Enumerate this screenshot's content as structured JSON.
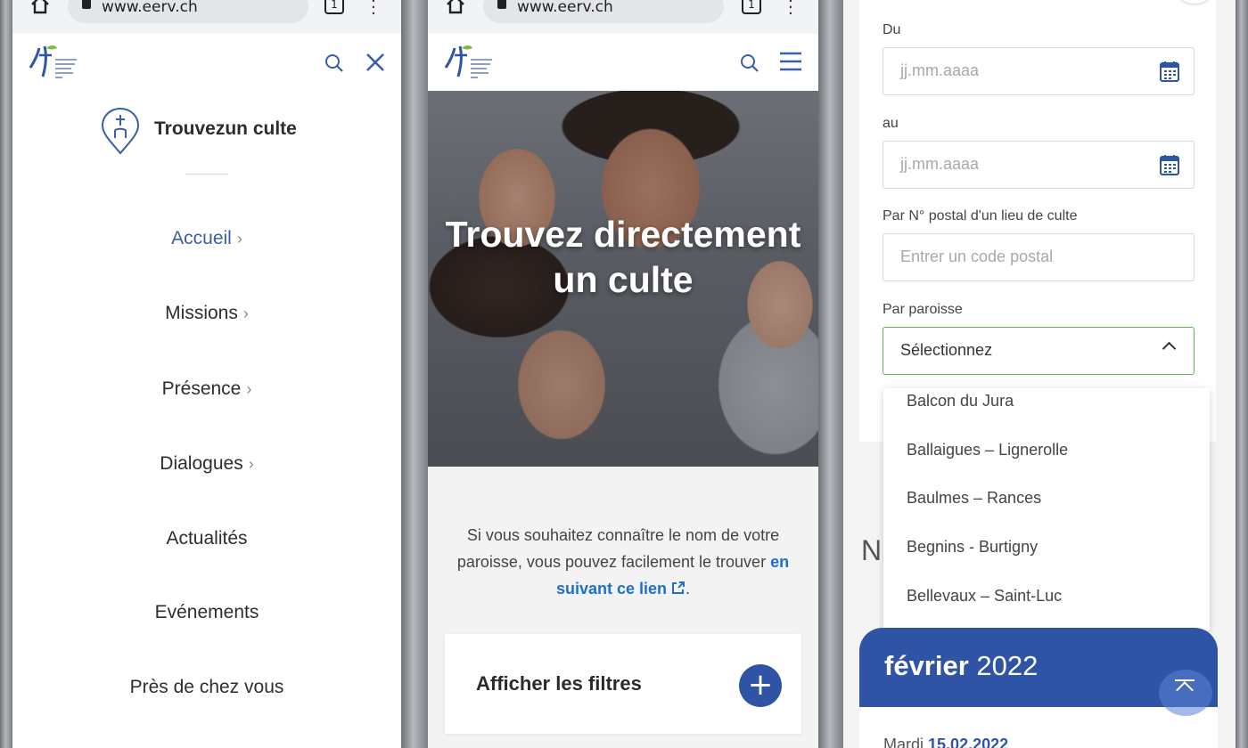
{
  "browser": {
    "url": "www.eerv.ch",
    "tab_count": "1"
  },
  "menu": {
    "find_title": "Trouvezun culte",
    "items": [
      {
        "label": "Accueil",
        "chevron": "›"
      },
      {
        "label": "Missions",
        "chevron": "›"
      },
      {
        "label": "Présence",
        "chevron": "›"
      },
      {
        "label": "Dialogues",
        "chevron": "›"
      },
      {
        "label": "Actualités"
      },
      {
        "label": "Evénements"
      },
      {
        "label": "Près de chez vous"
      }
    ]
  },
  "landing": {
    "hero_title": "Trouvez directement un culte",
    "intro_before": "Si vous souhaitez connaître le nom de votre paroisse, vous pouvez facilement le trouver ",
    "intro_link": "en suivant ce lien",
    "intro_after": ".",
    "filters_label": "Afficher les filtres",
    "plus": "+"
  },
  "form": {
    "from_label": "Du",
    "from_placeholder": "jj.mm.aaaa",
    "to_label": "au",
    "to_placeholder": "jj.mm.aaaa",
    "postal_label": "Par N° postal d'un lieu de culte",
    "postal_placeholder": "Entrer un code postal",
    "parish_label": "Par paroisse",
    "parish_selected": "Sélectionnez",
    "parish_options": [
      "Balcon du Jura",
      "Ballaigues – Lignerolle",
      "Baulmes – Rances",
      "Begnins - Burtigny",
      "Bellevaux – Saint-Luc"
    ]
  },
  "calendar": {
    "partial_heading": "N",
    "month": "février",
    "year": "2022",
    "day_prefix": "Mardi",
    "day_date": "15.02.2022"
  },
  "colors": {
    "brand_blue": "#2f54a6",
    "link_blue": "#1c6fd0",
    "valid_green": "#5fb44e"
  }
}
